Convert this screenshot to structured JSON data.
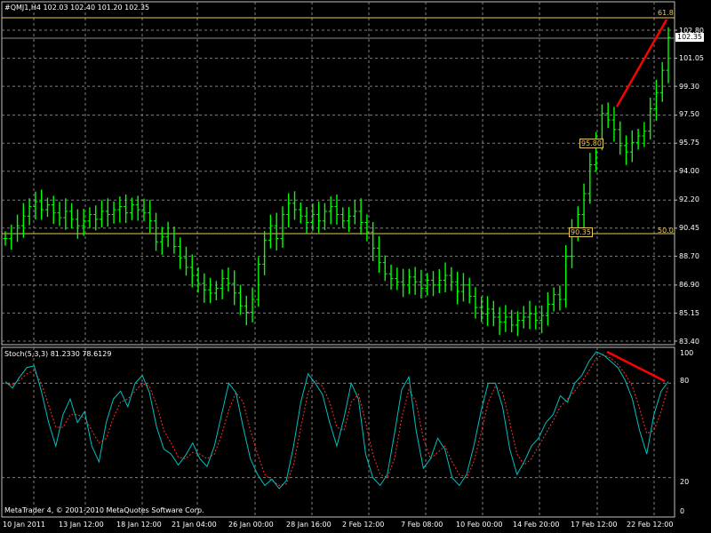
{
  "app": {
    "header": "#QMJ1,H4  102.03 102.40 101.20 102.35",
    "copyright": "MetaTrader 4, © 2001-2010 MetaQuotes Software Corp."
  },
  "indicator": {
    "header": "Stoch(5,3,3) 81.2330 78.6129"
  },
  "price_badge": "102.35",
  "levels": {
    "fibo_618": "61.8",
    "fibo_50": "50.0",
    "box_upper": "95.80",
    "box_lower": "90.35"
  },
  "colors": {
    "background": "#000000",
    "grid": "#7f7f7f",
    "candle": "#00ff00",
    "level_line": "#e8c85a",
    "trend_line": "#ff0000",
    "stoch_main": "#00c0c0",
    "stoch_signal": "#ff3030"
  },
  "chart_data": [
    {
      "type": "bar",
      "symbol": "#QMJ1",
      "timeframe": "H4",
      "yticks": [
        "102.80",
        "101.05",
        "99.30",
        "97.50",
        "95.75",
        "94.00",
        "92.20",
        "90.45",
        "88.70",
        "86.90",
        "85.15",
        "83.40"
      ],
      "ylim": [
        83.4,
        102.8
      ],
      "xticks": [
        "10 Jan 2011",
        "13 Jan 12:00",
        "18 Jan 12:00",
        "21 Jan 04:00",
        "26 Jan 00:00",
        "28 Jan 16:00",
        "2 Feb 12:00",
        "7 Feb 08:00",
        "10 Feb 00:00",
        "14 Feb 20:00",
        "17 Feb 12:00",
        "22 Feb 12:00"
      ],
      "last_price": 102.35,
      "series_close": [
        89.8,
        90.1,
        90.6,
        91.2,
        91.8,
        92.1,
        91.6,
        91.9,
        91.4,
        91.1,
        91.5,
        91.0,
        90.6,
        90.9,
        91.3,
        91.0,
        91.5,
        91.3,
        91.6,
        91.8,
        91.4,
        91.9,
        91.6,
        91.4,
        90.9,
        89.6,
        89.9,
        90.1,
        89.3,
        88.6,
        88.0,
        87.5,
        87.0,
        86.6,
        86.4,
        86.7,
        87.3,
        87.0,
        86.4,
        85.6,
        85.2,
        86.0,
        88.2,
        89.7,
        90.6,
        89.8,
        91.3,
        92.0,
        91.6,
        91.2,
        90.8,
        91.3,
        90.9,
        91.5,
        91.8,
        91.3,
        90.9,
        91.2,
        91.5,
        90.8,
        90.2,
        89.2,
        88.3,
        87.6,
        87.3,
        87.1,
        86.9,
        87.4,
        87.1,
        86.7,
        87.2,
        86.9,
        87.2,
        87.5,
        87.1,
        86.5,
        86.9,
        86.2,
        85.5,
        85.1,
        85.4,
        84.9,
        84.6,
        84.9,
        84.4,
        84.7,
        84.9,
        85.1,
        84.7,
        85.0,
        85.7,
        86.3,
        86.0,
        88.7,
        90.2,
        91.3,
        92.6,
        94.4,
        96.0,
        97.6,
        97.2,
        96.6,
        95.6,
        95.2,
        95.8,
        96.2,
        96.5,
        97.9,
        98.9,
        100.3,
        102.35
      ],
      "horizontal_levels": [
        {
          "label": "61.8",
          "value": 103.25
        },
        {
          "label": "50.0",
          "value": 90.35
        }
      ]
    },
    {
      "type": "line",
      "name": "Stoch(5,3,3)",
      "ylim": [
        0,
        100
      ],
      "yticks": [
        "100",
        "80",
        "20",
        "0"
      ],
      "series": [
        {
          "name": "main",
          "values": [
            81,
            77,
            84,
            90,
            91,
            75,
            55,
            40,
            60,
            70,
            55,
            62,
            40,
            30,
            55,
            70,
            75,
            65,
            80,
            85,
            74,
            52,
            38,
            35,
            28,
            34,
            42,
            32,
            27,
            40,
            60,
            80,
            74,
            52,
            32,
            22,
            15,
            19,
            13,
            18,
            40,
            68,
            86,
            80,
            73,
            55,
            40,
            58,
            80,
            70,
            35,
            20,
            15,
            22,
            48,
            76,
            84,
            50,
            26,
            32,
            45,
            38,
            20,
            15,
            22,
            40,
            62,
            80,
            80,
            65,
            38,
            22,
            30,
            40,
            45,
            55,
            60,
            72,
            68,
            80,
            85,
            94,
            100,
            98,
            94,
            90,
            82,
            70,
            50,
            35,
            60,
            75,
            81
          ]
        },
        {
          "name": "signal",
          "values": [
            80,
            79,
            82,
            86,
            88,
            80,
            66,
            52,
            52,
            60,
            60,
            58,
            50,
            42,
            45,
            58,
            68,
            70,
            75,
            80,
            78,
            66,
            50,
            42,
            33,
            32,
            36,
            35,
            32,
            35,
            47,
            63,
            74,
            68,
            50,
            35,
            22,
            18,
            15,
            16,
            28,
            52,
            74,
            82,
            78,
            68,
            52,
            50,
            68,
            73,
            55,
            35,
            22,
            20,
            32,
            58,
            76,
            68,
            45,
            32,
            36,
            40,
            30,
            22,
            20,
            30,
            48,
            68,
            78,
            74,
            55,
            35,
            28,
            32,
            40,
            48,
            56,
            65,
            70,
            75,
            81,
            88,
            96,
            98,
            96,
            92,
            86,
            78,
            64,
            48,
            50,
            62,
            78.6
          ]
        }
      ]
    }
  ]
}
